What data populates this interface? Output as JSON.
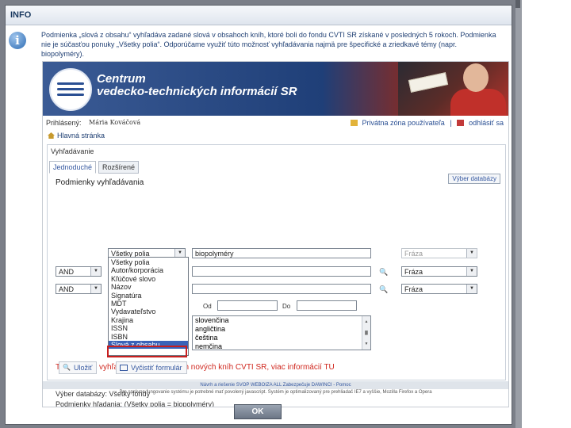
{
  "dialog": {
    "title": "INFO",
    "message": "Podmienka „slová z obsahu“ vyhľadáva zadané slová v obsahoch kníh, ktoré boli do fondu CVTI SR získané v posledných 5 rokoch. Podmienka nie je súčasťou ponuky „Všetky polia“. Odporúčame využiť túto možnosť vyhľadávania najmä pre špecifické a zriedkavé témy (napr. biopolyméry).",
    "ok_label": "OK"
  },
  "site": {
    "banner_line1": "Centrum",
    "banner_line2": "vedecko-technických informácií SR",
    "login_label": "Prihlásený:",
    "user_name": "Mária Kováčová",
    "private_zone": "Privátna zóna používateľa",
    "separator": "|",
    "logout": "odhlásiť sa",
    "home": "Hlavná stránka"
  },
  "search": {
    "panel_title": "Vyhľadávanie",
    "tabs": [
      "Jednoduché",
      "Rozšírené"
    ],
    "conditions_title": "Podmienky vyhľadávania",
    "db_button": "Výber databázy",
    "row1_field": "Všetky polia",
    "row1_value": "biopolyméry",
    "row1_mode": "Fráza",
    "row2_op": "AND",
    "row2_mode": "Fráza",
    "row3_op": "AND",
    "row3_mode": "Fráza",
    "from_label": "Od",
    "to_label": "Do",
    "field_options": [
      "Všetky polia",
      "Autor/korporácia",
      "Kľúčové slovo",
      "Názov",
      "Signatúra",
      "MDT",
      "Vydavateľstvo",
      "Krajina",
      "ISSN",
      "ISBN",
      "Slová z obsahu"
    ],
    "languages": [
      "slovenčina",
      "angličtina",
      "čeština",
      "nemčina"
    ],
    "tip": "TIP: využite vyhľadávanie v obsahoch nových kníh CVTI SR, viac informácií TU",
    "db_choice": "Výber databázy:  Všetky fondy",
    "conditions_summary": "Podmienky hľadania: (Všetky polia = biopolyméry)",
    "save_button": "Uložiť",
    "clear_button": "Vyčistiť formulár"
  },
  "footer": {
    "line1": "Návrh a riešenie SVOP WEBOIZA ALL Zabezpečuje DAWINCI - Pomoc",
    "line2": "Pre správne fungovanie systému je potrebné mať povolený javascript. Systém je optimalizovaný pre prehliadač IE7 a vyššie, Mozilla Firefox a Opera"
  },
  "colors": {
    "link": "#3558a0",
    "tip": "#d0281f",
    "selection": "#3a63b8",
    "highlight_box": "#c81e1e"
  }
}
